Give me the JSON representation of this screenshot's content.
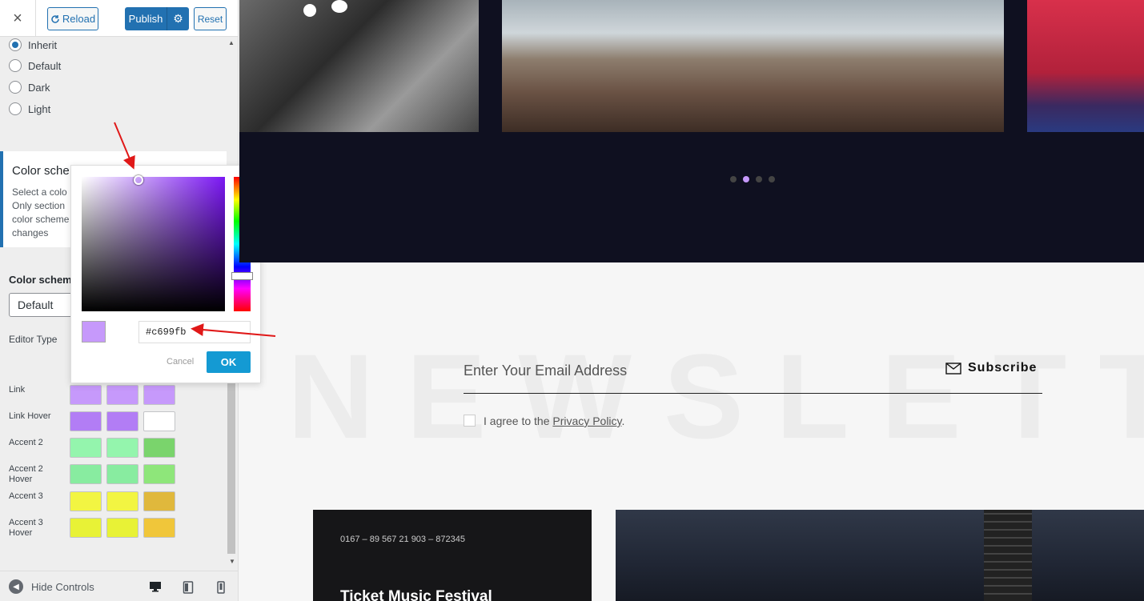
{
  "topbar": {
    "close_icon": "×",
    "reload_label": "Reload",
    "publish_label": "Publish",
    "reset_label": "Reset"
  },
  "radios": [
    {
      "label": "Inherit",
      "checked": true
    },
    {
      "label": "Default",
      "checked": false
    },
    {
      "label": "Dark",
      "checked": false
    },
    {
      "label": "Light",
      "checked": false
    }
  ],
  "section": {
    "title": "Color sche",
    "description": "Select a colo Only section color scheme changes"
  },
  "color_scheme": {
    "label": "Color schem",
    "selected": "Default"
  },
  "editor_type_label": "Editor Type",
  "swatches": [
    {
      "label": "Link",
      "colors": [
        "#c699fb",
        "#c699fb",
        "#c699fb"
      ]
    },
    {
      "label": "Link Hover",
      "colors": [
        "#b27df5",
        "#b27df5",
        "#ffffff"
      ]
    },
    {
      "label": "Accent 2",
      "colors": [
        "#94f5ad",
        "#94f5ad",
        "#7ad46c"
      ]
    },
    {
      "label": "Accent 2 Hover",
      "colors": [
        "#88eca0",
        "#88eca0",
        "#8ee67a"
      ]
    },
    {
      "label": "Accent 3",
      "colors": [
        "#f2f542",
        "#f2f542",
        "#e0b83c"
      ]
    },
    {
      "label": "Accent 3 Hover",
      "colors": [
        "#e8f236",
        "#e8f236",
        "#f0c63a"
      ]
    }
  ],
  "footer": {
    "hide_controls_label": "Hide Controls"
  },
  "picker": {
    "hex_value": "#c699fb",
    "cancel_label": "Cancel",
    "ok_label": "OK"
  },
  "preview": {
    "newsletter_bg": "NEWSLETTER",
    "email_placeholder": "Enter Your Email Address",
    "subscribe_label": "Subscribe",
    "agree_text": "I agree to the",
    "privacy_link": "Privacy Policy",
    "agree_suffix": ".",
    "card_phone": "0167 – 89 567 21 903 – 872345",
    "card_title": "Ticket Music Festival"
  },
  "colors": {
    "accent": "#2271b1",
    "picker_value": "#c699fb",
    "ok_button": "#149ad3",
    "dark_band": "#0f1020"
  }
}
